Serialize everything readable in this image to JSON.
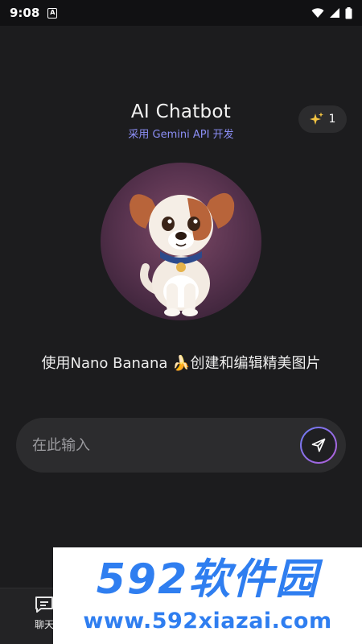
{
  "status_bar": {
    "time": "9:08",
    "a_badge": "A",
    "icons": [
      "notification-a-icon",
      "wifi-icon",
      "cellular-icon",
      "battery-icon"
    ]
  },
  "header": {
    "title": "AI Chatbot",
    "subtitle": "采用 Gemini API 开发"
  },
  "credits": {
    "icon": "sparkle-icon",
    "count": "1"
  },
  "hero": {
    "image": "puppy-illustration"
  },
  "tagline": "使用Nano Banana 🍌创建和编辑精美图片",
  "input": {
    "placeholder": "在此输入",
    "value": ""
  },
  "send": {
    "icon": "send-icon"
  },
  "bottom_nav": {
    "items": [
      {
        "label": "聊天",
        "icon": "chat-icon"
      }
    ]
  },
  "watermark": {
    "brand": "592软件园",
    "url": "www.592xiazai.com"
  },
  "colors": {
    "background": "#1c1c1e",
    "surface": "#2c2c2e",
    "accent": "#8b8ef5",
    "watermark": "#2f7ef0"
  }
}
